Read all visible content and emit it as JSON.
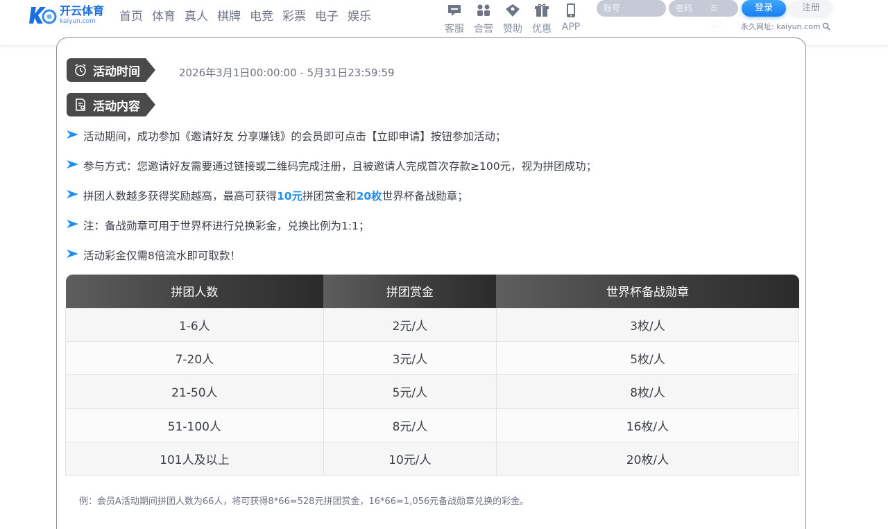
{
  "header": {
    "logo_cn": "开云体育",
    "logo_en": "kaiyun.com",
    "nav": [
      "首页",
      "体育",
      "真人",
      "棋牌",
      "电竞",
      "彩票",
      "电子",
      "娱乐"
    ],
    "quick_links": [
      {
        "label": "客服",
        "icon": "chat-icon"
      },
      {
        "label": "合营",
        "icon": "partners-icon"
      },
      {
        "label": "赞助",
        "icon": "diamond-icon"
      },
      {
        "label": "优惠",
        "icon": "gift-icon"
      },
      {
        "label": "APP",
        "icon": "phone-icon"
      }
    ],
    "login": {
      "account_placeholder": "账号",
      "password_placeholder": "密码",
      "forgot": "忘记?",
      "login_label": "登录",
      "register_label": "注册",
      "permalink": "永久网址: kaiyun.com"
    }
  },
  "content": {
    "time_tag": "活动时间",
    "time_value": "2026年3月1日00:00:00 - 5月31日23:59:59",
    "content_tag": "活动内容",
    "rules": [
      {
        "parts": [
          "活动期间，成功参加《邀请好友 分享赚钱》的会员即可点击【立即申请】按钮参加活动；"
        ]
      },
      {
        "parts": [
          "参与方式：您邀请好友需要通过链接或二维码完成注册，且被邀请人完成首次存款≥100元，视为拼团成功；"
        ]
      },
      {
        "parts": [
          "拼团人数越多获得奖励越高，最高可获得",
          "10元",
          "拼团赏金和",
          "20枚",
          "世界杯备战勋章；"
        ]
      },
      {
        "parts": [
          "注：备战勋章可用于世界杯进行兑换彩金，兑换比例为1:1；"
        ]
      },
      {
        "parts": [
          "活动彩金仅需8倍流水即可取款！"
        ]
      }
    ],
    "table": {
      "headers": [
        "拼团人数",
        "拼团赏金",
        "世界杯备战勋章"
      ],
      "rows": [
        [
          "1-6人",
          "2元/人",
          "3枚/人"
        ],
        [
          "7-20人",
          "3元/人",
          "5枚/人"
        ],
        [
          "21-50人",
          "5元/人",
          "8枚/人"
        ],
        [
          "51-100人",
          "8元/人",
          "16枚/人"
        ],
        [
          "101人及以上",
          "10元/人",
          "20枚/人"
        ]
      ]
    },
    "example": "例：会员A活动期间拼团人数为66人，将可获得8*66=528元拼团赏金，16*66=1,056元备战勋章兑换的彩金。"
  },
  "colors": {
    "highlight": "#1e8ff2",
    "tag_bg": "#4a4a4a",
    "login_button": "#1a7ff0"
  }
}
